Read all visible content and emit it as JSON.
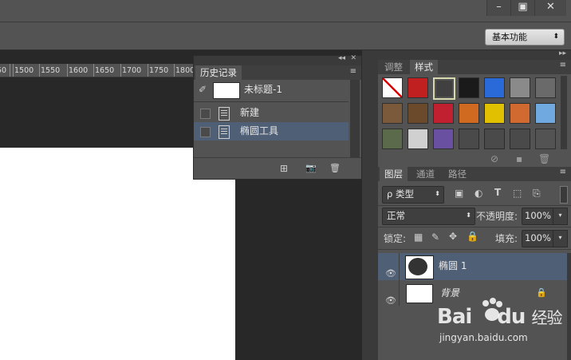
{
  "window_controls": {
    "minimize": "–",
    "restore": "▣",
    "close": "✕"
  },
  "workspace": {
    "label": "基本功能",
    "arrow": "⬍"
  },
  "ruler": {
    "ticks": [
      "50",
      "1500",
      "1550",
      "1600",
      "1650",
      "1700",
      "1750",
      "1800"
    ]
  },
  "history_panel": {
    "tab": "历史记录",
    "snapshot": {
      "label": "未标题-1"
    },
    "items": [
      {
        "label": "新建"
      },
      {
        "label": "椭圆工具"
      }
    ],
    "collapse_glyph": "◂◂",
    "close_glyph": "✕",
    "menu_glyph": "≡",
    "footer": {
      "new_doc": "⊞",
      "snapshot": "📷",
      "delete": "🗑"
    }
  },
  "styles_panel": {
    "tabs": [
      "调整",
      "样式"
    ],
    "active_tab": "样式",
    "swatch_colors": [
      [
        "#ffffff",
        "#c02020",
        "#404040",
        "#1a1a1a",
        "#2a6ad8",
        "#8a8a8a",
        "#6a6a6a"
      ],
      [
        "#7a5a3a",
        "#6a4a2a",
        "#c02030",
        "#d06a20",
        "#e0c000",
        "#d06a30",
        "#70a8e0"
      ],
      [
        "#5a6a4a",
        "#d0d0d0",
        "#6a50a0",
        "#4a4a4a",
        "#4a4a4a",
        "#4a4a4a",
        "#535353"
      ]
    ]
  },
  "layers_panel": {
    "tabs": [
      "图层",
      "通道",
      "路径"
    ],
    "active_tab": "图层",
    "filter_label": "ρ 类型",
    "blend_mode": "正常",
    "opacity_label": "不透明度:",
    "opacity_value": "100%",
    "lock_label": "锁定:",
    "fill_label": "填充:",
    "fill_value": "100%",
    "layers": [
      {
        "name": "椭圆 1",
        "selected": true
      },
      {
        "name": "背景",
        "selected": false
      }
    ]
  },
  "watermark": {
    "brand": "Bai",
    "brand2": "经验",
    "du": "du",
    "url": "jingyan.baidu.com"
  },
  "colors": {
    "panel": "#535353",
    "selected": "#4f5f75",
    "dark": "#282828"
  }
}
